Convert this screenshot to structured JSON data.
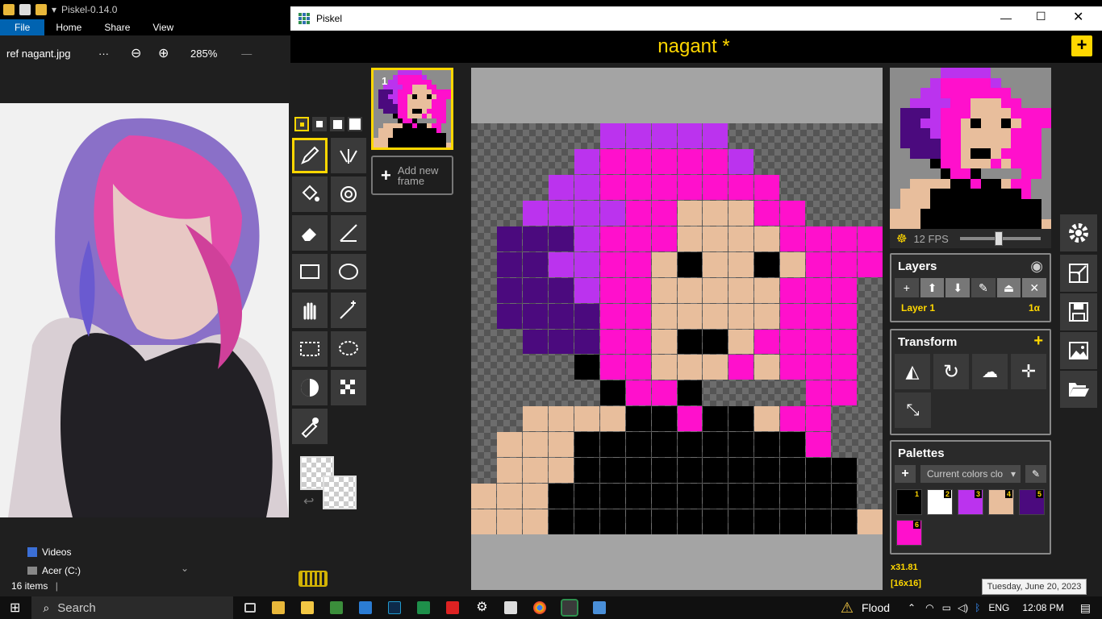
{
  "explorer": {
    "title": "Piskel-0.14.0",
    "ribbon": [
      "File",
      "Home",
      "Share",
      "View"
    ],
    "viewer_file": "ref nagant.jpg",
    "viewer_more": "···",
    "zoom_level": "285%",
    "tree_items": [
      "Videos",
      "Acer (C:)"
    ],
    "item_count": "16 items"
  },
  "piskel": {
    "window_title": "Piskel",
    "doc_title": "nagant *",
    "frame_number": "1",
    "add_frame_label": "Add new frame",
    "fps_label": "12 FPS",
    "fps_value": 12,
    "layers_title": "Layers",
    "layer_name": "Layer 1",
    "layer_alpha": "1α",
    "transform_title": "Transform",
    "palettes_title": "Palettes",
    "palette_select": "Current colors clo",
    "palette_colors": [
      {
        "n": "1",
        "c": "#000000"
      },
      {
        "n": "2",
        "c": "#ffffff"
      },
      {
        "n": "3",
        "c": "#bb33ee"
      },
      {
        "n": "4",
        "c": "#e8be9c"
      },
      {
        "n": "5",
        "c": "#4b0a7e"
      },
      {
        "n": "6",
        "c": "#ff10cc"
      }
    ],
    "cursor_coords": "x31.81",
    "size_label": "[16x16]",
    "accent": "#ffd700",
    "sprite_colors": {
      "p": "#ff10cc",
      "v": "#bb33ee",
      "d": "#4b0a7e",
      "s": "#e8be9c",
      "k": "#000000",
      "t": ""
    },
    "sprite_rows": [
      "tttttvvvvvtttttt",
      "ttttvpppppvttttt",
      "tttvvppppppptttt",
      "ttvvvvppsssppttt",
      "tdddvpppsssspppp",
      "tddvvppskssksppp",
      "tdddvppsssssppp",
      "tddddppssssspppt",
      "ttdddppskksppppt",
      "ttttkppssspsppp",
      "tttttkppkttttppt",
      "ttsssskkpkkspptt",
      "tssskkkkkkkkkptt",
      "tssskkkkkkkkkkkt",
      "ssskkkkkkkkkkkkt",
      "ssskkkkkkkkkkkks"
    ]
  },
  "taskbar": {
    "search": "Search",
    "weather": "Flood",
    "language": "ENG",
    "time": "12:08 PM",
    "date_tooltip": "Tuesday, June 20, 2023"
  }
}
